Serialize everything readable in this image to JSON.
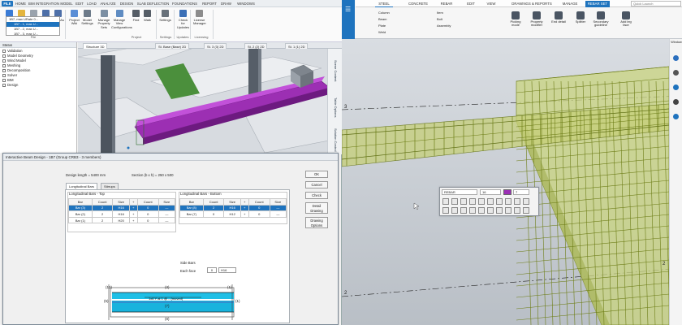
{
  "left": {
    "menu_tabs": [
      "FILE",
      "HOME",
      "BIM INTEGRATION",
      "MODEL",
      "EDIT",
      "LOAD",
      "ANALYZE",
      "DESIGN",
      "SLAB DEFLECTION",
      "FOUNDATIONS",
      "REPORT",
      "DRAW",
      "WINDOWS"
    ],
    "ribbon_buttons": [
      {
        "label": "New",
        "icon": "new-icon",
        "color": "#3a7bd5"
      },
      {
        "label": "Open",
        "icon": "open-icon",
        "color": "#e4b53d"
      },
      {
        "label": "Close",
        "icon": "close-icon",
        "color": "#9aa3ad"
      },
      {
        "label": "Save",
        "icon": "save-icon",
        "color": "#4d6fa8"
      },
      {
        "label": "Save As",
        "icon": "save-as-icon",
        "color": "#4d6fa8"
      },
      {
        "label": "Project Wiki",
        "icon": "wiki-icon",
        "color": "#5a8ed6"
      },
      {
        "label": "Model Settings",
        "icon": "model-settings-icon",
        "color": "#6c7a89"
      },
      {
        "label": "Manage Property Sets",
        "icon": "property-sets-icon",
        "color": "#7c8fa3"
      },
      {
        "label": "Manage View Configurations",
        "icon": "view-config-icon",
        "color": "#5f8cc2"
      },
      {
        "label": "Find",
        "icon": "find-icon",
        "color": "#555d66"
      },
      {
        "label": "Walk",
        "icon": "walk-icon",
        "color": "#555d66"
      },
      {
        "label": "Settings",
        "icon": "settings-icon",
        "color": "#68717a"
      },
      {
        "label": "Check for Updates",
        "icon": "updates-icon",
        "color": "#3b6fb6"
      },
      {
        "label": "License Manager",
        "icon": "license-icon",
        "color": "#8c8c8c"
      }
    ],
    "ribbon_groups": [
      "File",
      "Project",
      "Settings",
      "Updates",
      "Licensing"
    ],
    "status": {
      "title": "Status",
      "items": [
        "Validation",
        "Model Geometry",
        "Wind Model",
        "Meshing",
        "Decomposition",
        "Solver",
        "BIM",
        "Design"
      ]
    },
    "view_tabs": [
      "Structure 3D",
      "St. Base (Base) 2D",
      "St. 3 (3) 2D",
      "St. 2 (2) 2D",
      "St. 1 (1) 2D"
    ],
    "side_labels": [
      "Scene Content",
      "Table Options",
      "Solution Control"
    ],
    "dialog": {
      "title": "Interactive Beam Design - 1B7 (Group CRB3 - 3 members)",
      "member_tree": [
        "1B7, max URate 0...",
        "1B7 - 1, max U...",
        "1B7 - 2, max U...",
        "1B7 - 3, max U..."
      ],
      "design_length": "Design length = 5400 mm",
      "section": "Section (b x h) = 250 x 500",
      "tabs": [
        "Longitudinal Bars",
        "Stirrups"
      ],
      "top_title": "Longitudinal Bars - Top",
      "bottom_title": "Longitudinal Bars - Bottom",
      "columns": [
        "Bar",
        "Count",
        "Size",
        "+",
        "Count",
        "Size"
      ],
      "top_rows": [
        {
          "bar": "Bar (3)",
          "count": "2",
          "size": "H16",
          "plus": "+",
          "count2": "0",
          "size2": "—"
        },
        {
          "bar": "Bar (2)",
          "count": "2",
          "size": "H16",
          "plus": "+",
          "count2": "0",
          "size2": "—"
        },
        {
          "bar": "Bar (1)",
          "count": "2",
          "size": "H20",
          "plus": "+",
          "count2": "0",
          "size2": "—"
        }
      ],
      "bottom_rows": [
        {
          "bar": "Bar (8)",
          "count": "2",
          "size": "H16",
          "plus": "+",
          "count2": "0",
          "size2": "—"
        },
        {
          "bar": "Bar (7)",
          "count": "0",
          "size": "H12",
          "plus": "+",
          "count2": "0",
          "size2": "—"
        }
      ],
      "side_bars": {
        "title": "Side Bars",
        "each_face_label": "Each face",
        "count": "0",
        "size": "H16"
      },
      "buttons": [
        "OK",
        "Cancel",
        "Check",
        "Detail Drawing",
        "Drawing Options"
      ],
      "section_labels": [
        "(12)",
        "(3)",
        "(1)",
        "(5)",
        "(7)",
        "(8)",
        "(1)"
      ],
      "section_note": "1x6 Y at 1 @ ...(moved)"
    }
  },
  "right": {
    "menu_tabs": [
      "STEEL",
      "CONCRETE",
      "REBAR",
      "EDIT",
      "VIEW",
      "DRAWINGS & REPORTS",
      "MANAGE",
      "REBAR SET"
    ],
    "search_placeholder": "Quick Launch",
    "steel_items": [
      "Column",
      "Beam",
      "Plate",
      "Weld"
    ],
    "mid_items": [
      "Item",
      "Bolt",
      "Assembly"
    ],
    "tools": [
      {
        "label": "Picking mode",
        "icon": "picking-mode-icon",
        "color": "#4a5563"
      },
      {
        "label": "Property modifier",
        "icon": "property-modifier-icon",
        "color": "#4a5563"
      },
      {
        "label": "End detail",
        "icon": "end-detail-icon",
        "color": "#4a5563"
      },
      {
        "label": "Splitter",
        "icon": "splitter-icon",
        "color": "#4a5563"
      },
      {
        "label": "Secondary guideline",
        "icon": "secondary-guideline-icon",
        "color": "#4a5563"
      },
      {
        "label": "Add leg face",
        "icon": "add-leg-face-icon",
        "color": "#4a5563"
      }
    ],
    "window_label": "Window",
    "grid_labels": [
      "3",
      "2",
      "2"
    ],
    "picker": {
      "title": "REBAR",
      "value": "16",
      "color_value": "7",
      "color": "#9b2fb5"
    }
  },
  "colors": {
    "accent": "#1e73be",
    "beam": "#8a1fa3",
    "rebar_green": "#b7c864",
    "slab": "#c6d27f"
  }
}
